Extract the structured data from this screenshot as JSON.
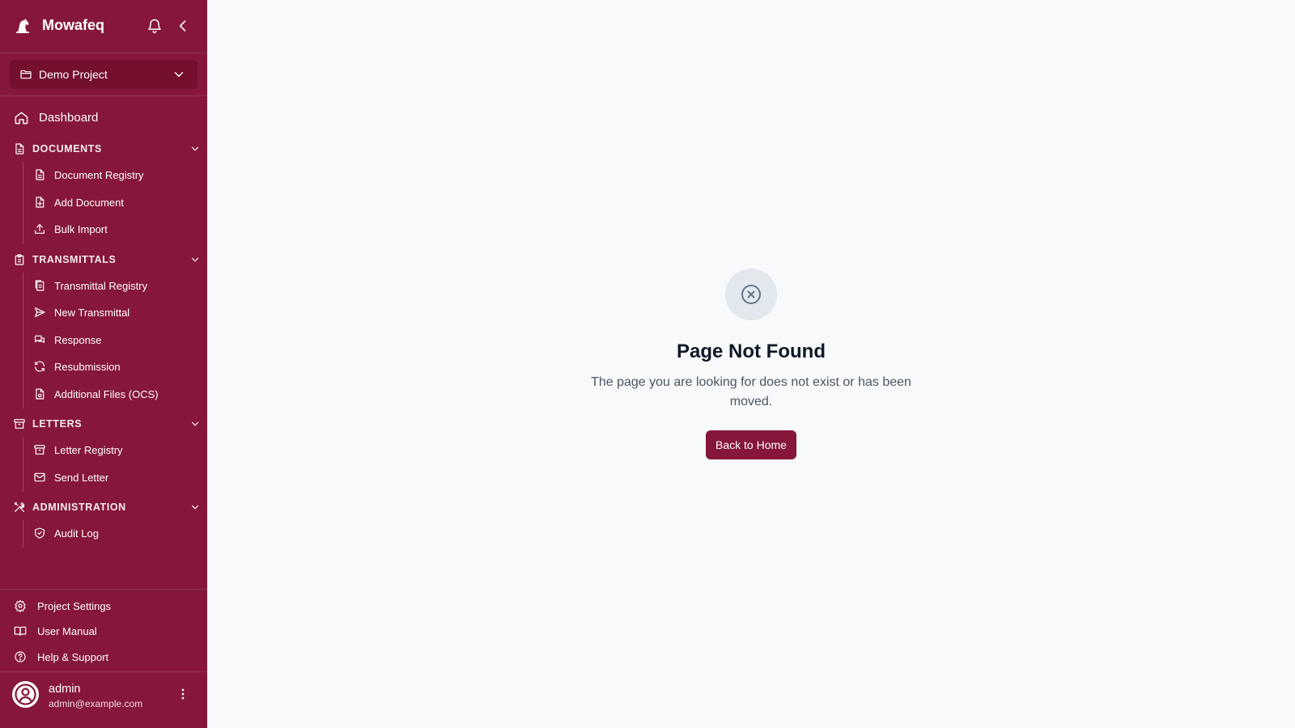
{
  "app": {
    "name": "Mowafeq"
  },
  "project": {
    "selected": "Demo Project"
  },
  "nav": {
    "dashboard": "Dashboard",
    "groups": [
      {
        "title": "DOCUMENTS",
        "items": [
          "Document Registry",
          "Add Document",
          "Bulk Import"
        ]
      },
      {
        "title": "TRANSMITTALS",
        "items": [
          "Transmittal Registry",
          "New Transmittal",
          "Response",
          "Resubmission",
          "Additional Files (OCS)"
        ]
      },
      {
        "title": "LETTERS",
        "items": [
          "Letter Registry",
          "Send Letter"
        ]
      },
      {
        "title": "ADMINISTRATION",
        "items": [
          "Audit Log"
        ]
      }
    ]
  },
  "footer": {
    "settings": "Project Settings",
    "manual": "User Manual",
    "help": "Help & Support"
  },
  "user": {
    "name": "admin",
    "email": "admin@example.com"
  },
  "not_found": {
    "title": "Page Not Found",
    "description": "The page you are looking for does not exist or has been moved.",
    "button": "Back to Home"
  },
  "colors": {
    "sidebar": "#86173a",
    "accent": "#86173a",
    "background": "#f8f9fb"
  }
}
